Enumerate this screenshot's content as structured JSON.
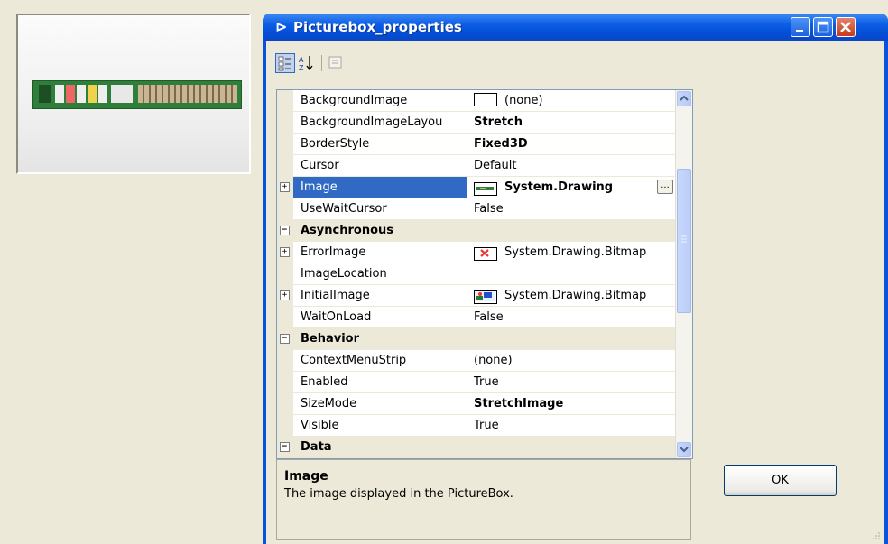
{
  "window": {
    "title": "Picturebox_properties",
    "colors": {
      "titlebar": "#0a53d8",
      "selection": "#316ac5",
      "face": "#ece9d8"
    }
  },
  "toolbar": {
    "categorized_icon": "categorized-icon",
    "alphabetical_icon": "alphabetical-icon",
    "property_pages_icon": "property-pages-icon"
  },
  "grid": {
    "rows": [
      {
        "name": "BackgroundImage",
        "value": "(none)",
        "kind": "prop",
        "swatch": "blank"
      },
      {
        "name": "BackgroundImageLayou",
        "value": "Stretch",
        "kind": "prop",
        "bold": true
      },
      {
        "name": "BorderStyle",
        "value": "Fixed3D",
        "kind": "prop",
        "bold": true
      },
      {
        "name": "Cursor",
        "value": "Default",
        "kind": "prop"
      },
      {
        "name": "Image",
        "value": "System.Drawing",
        "kind": "prop",
        "bold": true,
        "selected": true,
        "expander": "+",
        "swatch": "board-thumb",
        "ellipsis": "..."
      },
      {
        "name": "UseWaitCursor",
        "value": "False",
        "kind": "prop"
      },
      {
        "name": "Asynchronous",
        "kind": "category",
        "expander": "−"
      },
      {
        "name": "ErrorImage",
        "value": "System.Drawing.Bitmap",
        "kind": "prop",
        "expander": "+",
        "swatch": "error-thumb"
      },
      {
        "name": "ImageLocation",
        "value": "",
        "kind": "prop"
      },
      {
        "name": "InitialImage",
        "value": "System.Drawing.Bitmap",
        "kind": "prop",
        "expander": "+",
        "swatch": "initial-thumb"
      },
      {
        "name": "WaitOnLoad",
        "value": "False",
        "kind": "prop"
      },
      {
        "name": "Behavior",
        "kind": "category",
        "expander": "−"
      },
      {
        "name": "ContextMenuStrip",
        "value": "(none)",
        "kind": "prop"
      },
      {
        "name": "Enabled",
        "value": "True",
        "kind": "prop"
      },
      {
        "name": "SizeMode",
        "value": "StretchImage",
        "kind": "prop",
        "bold": true
      },
      {
        "name": "Visible",
        "value": "True",
        "kind": "prop"
      },
      {
        "name": "Data",
        "kind": "category",
        "expander": "−"
      }
    ]
  },
  "help": {
    "title": "Image",
    "description": "The image displayed in the PictureBox."
  },
  "ok_button": {
    "label": "OK"
  }
}
